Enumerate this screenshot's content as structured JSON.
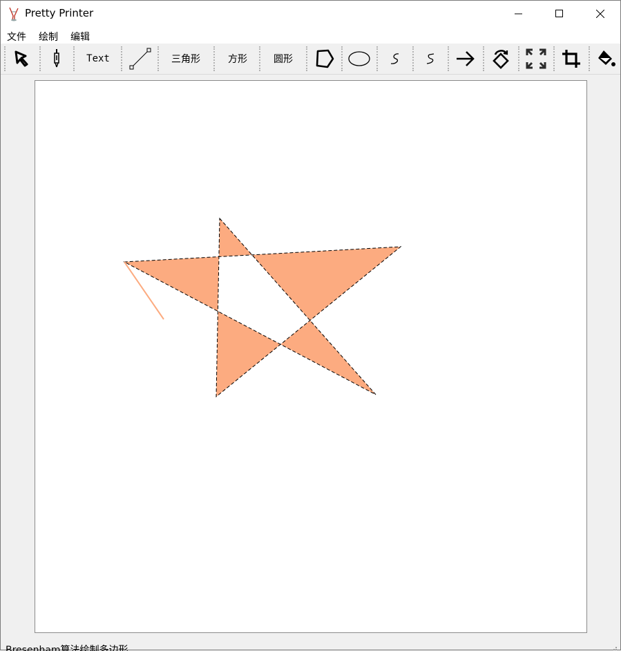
{
  "window": {
    "title": "Pretty Printer",
    "controls": {
      "minimize": "minimize-icon",
      "maximize": "maximize-icon",
      "close": "close-icon"
    }
  },
  "menu": {
    "items": [
      "文件",
      "绘制",
      "编辑"
    ]
  },
  "toolbar": {
    "text_label": "Text",
    "triangle_label": "三角形",
    "square_label": "方形",
    "circle_label": "圆形",
    "icons": [
      "select-cursor-icon",
      "pen-icon",
      "line-icon",
      "polygon-icon",
      "ellipse-icon",
      "curve-icon",
      "curve-alt-icon",
      "arrow-right-icon",
      "rotate-icon",
      "fullscreen-icon",
      "crop-icon",
      "fill-bucket-icon"
    ]
  },
  "canvas": {
    "shape": "self-intersecting polygon (star)",
    "fill_color": "#fcab80",
    "outline": "dashed black",
    "background": "#ffffff"
  },
  "status": {
    "text": "Bresenham算法绘制多边形"
  }
}
